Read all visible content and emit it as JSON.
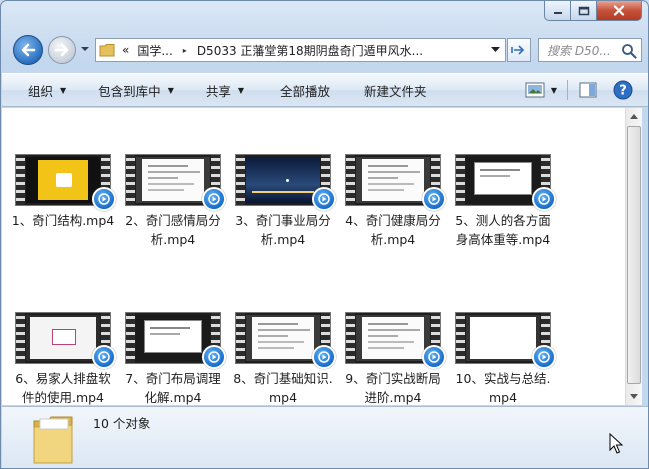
{
  "window": {
    "controls": {
      "minimize": "minimize",
      "maximize": "maximize",
      "close": "close"
    }
  },
  "address_bar": {
    "overflow_chevron": "«",
    "crumbs": [
      "国学...",
      "D5033 正藩堂第18期阴盘奇门遁甲风水..."
    ],
    "separator": "▸"
  },
  "search": {
    "placeholder": "搜索 D50..."
  },
  "toolbar": {
    "organize": "组织",
    "include_in_library": "包含到库中",
    "share": "共享",
    "play_all": "全部播放",
    "new_folder": "新建文件夹"
  },
  "files": [
    {
      "name": "1、奇门结构.mp4",
      "thumb": "yellow"
    },
    {
      "name": "2、奇门感情局分析.mp4",
      "thumb": "doc"
    },
    {
      "name": "3、奇门事业局分析.mp4",
      "thumb": "night"
    },
    {
      "name": "4、奇门健康局分析.mp4",
      "thumb": "doc"
    },
    {
      "name": "5、测人的各方面身高体重等.mp4",
      "thumb": "slide"
    },
    {
      "name": "6、易家人排盘软件的使用.mp4",
      "thumb": "app"
    },
    {
      "name": "7、奇门布局调理化解.mp4",
      "thumb": "slide"
    },
    {
      "name": "8、奇门基础知识.mp4",
      "thumb": "doc"
    },
    {
      "name": "9、奇门实战断局进阶.mp4",
      "thumb": "doc"
    },
    {
      "name": "10、实战与总结.mp4",
      "thumb": "blank"
    }
  ],
  "status": {
    "item_count": "10 个对象"
  },
  "colors": {
    "selection_blue": "#1569c7",
    "window_frame": "#c3d7ee"
  }
}
